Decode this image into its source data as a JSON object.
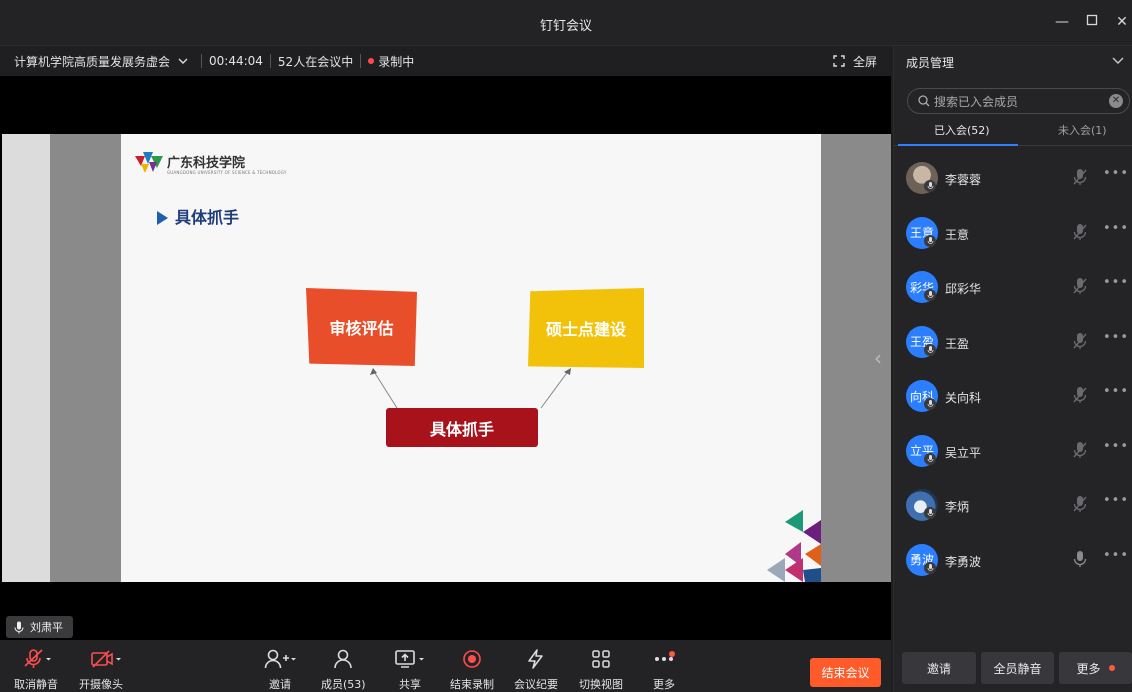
{
  "window": {
    "title": "钉钉会议"
  },
  "meeting_bar": {
    "meeting_name": "计算机学院高质量发展务虚会",
    "elapsed": "00:44:04",
    "participants_text": "52人在会议中",
    "recording_text": "录制中",
    "fullscreen_label": "全屏"
  },
  "slide": {
    "logo_text": "广东科技学院",
    "logo_subtext": "GUANGDONG UNIVERSITY OF SCIENCE & TECHNOLOGY",
    "heading": "具体抓手",
    "box_left": "审核评估",
    "box_right": "硕士点建设",
    "box_center": "具体抓手"
  },
  "speaker_label": "刘肃平",
  "toolbar": {
    "mute": "取消静音",
    "camera": "开摄像头",
    "invite": "邀请",
    "members": "成员(53)",
    "share": "共享",
    "stop_record": "结束录制",
    "minutes": "会议纪要",
    "switch_view": "切换视图",
    "more": "更多",
    "end_meeting": "结束会议"
  },
  "panel": {
    "title": "成员管理",
    "search_placeholder": "搜索已入会成员",
    "tab_joined": "已入会(52)",
    "tab_not_joined": "未入会(1)",
    "members": [
      {
        "name": "李蓉蓉",
        "avatar_text": "",
        "muted": true
      },
      {
        "name": "王意",
        "avatar_text": "王意",
        "muted": true
      },
      {
        "name": "邱彩华",
        "avatar_text": "彩华",
        "muted": true
      },
      {
        "name": "王盈",
        "avatar_text": "王盈",
        "muted": true
      },
      {
        "name": "关向科",
        "avatar_text": "向科",
        "muted": true
      },
      {
        "name": "吴立平",
        "avatar_text": "立平",
        "muted": true
      },
      {
        "name": "李炳",
        "avatar_text": "",
        "muted": true
      },
      {
        "name": "李勇波",
        "avatar_text": "勇波",
        "muted": false
      }
    ],
    "footer": {
      "invite": "邀请",
      "mute_all": "全员静音",
      "more": "更多"
    }
  },
  "colors": {
    "accent": "#2f7fff",
    "end_button": "#ff5a2a",
    "slide_orange": "#e84e2a",
    "slide_yellow": "#f2c20a",
    "slide_red": "#a8121a",
    "heading_blue": "#1f3d7a"
  }
}
